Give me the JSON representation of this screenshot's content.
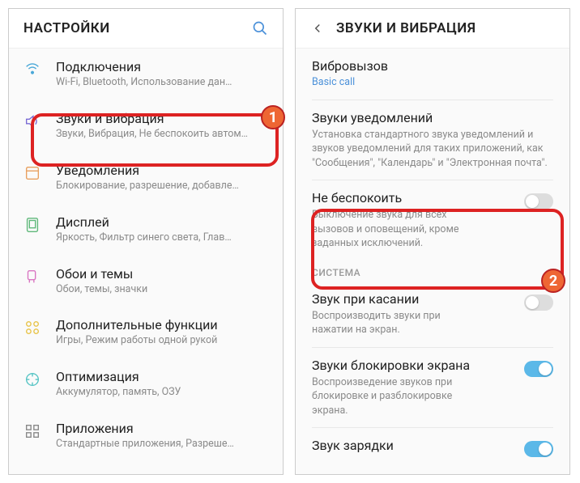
{
  "left": {
    "title": "НАСТРОЙКИ",
    "items": [
      {
        "title": "Подключения",
        "sub": "Wi-Fi, Bluetooth, Использование дан…"
      },
      {
        "title": "Звуки и вибрация",
        "sub": "Звуки, Вибрация, Не беспокоить автом…"
      },
      {
        "title": "Уведомления",
        "sub": "Блокирование, разрешение, добавле…"
      },
      {
        "title": "Дисплей",
        "sub": "Яркость, Фильтр синего света, Глав…"
      },
      {
        "title": "Обои и темы",
        "sub": "Обои, темы, значки"
      },
      {
        "title": "Дополнительные функции",
        "sub": "Игры, Режим работы одной рукой"
      },
      {
        "title": "Оптимизация",
        "sub": "Аккумулятор, память, ОЗУ"
      },
      {
        "title": "Приложения",
        "sub": "Стандартные приложения, Разреше…"
      }
    ]
  },
  "right": {
    "title": "ЗВУКИ И ВИБРАЦИЯ",
    "vibro": {
      "title": "Вибровызов",
      "sub": "Basic call"
    },
    "notif": {
      "title": "Звуки уведомлений",
      "sub": "Установка стандартного звука уведомлений и звуков уведомлений для таких приложений, как \"Сообщения\", \"Календарь\" и \"Электронная почта\"."
    },
    "dnd": {
      "title": "Не беспокоить",
      "sub": "Выключение звука для всех вызовов и оповещений, кроме заданных исключений."
    },
    "section": "СИСТЕМА",
    "touch": {
      "title": "Звук при касании",
      "sub": "Воспроизводить звуки при нажатии на экран."
    },
    "lock": {
      "title": "Звуки блокировки экрана",
      "sub": "Воспроизведение звуков при блокировке и разблокировке экрана."
    },
    "charge": {
      "title": "Звук зарядки"
    }
  },
  "badge1": "1",
  "badge2": "2"
}
